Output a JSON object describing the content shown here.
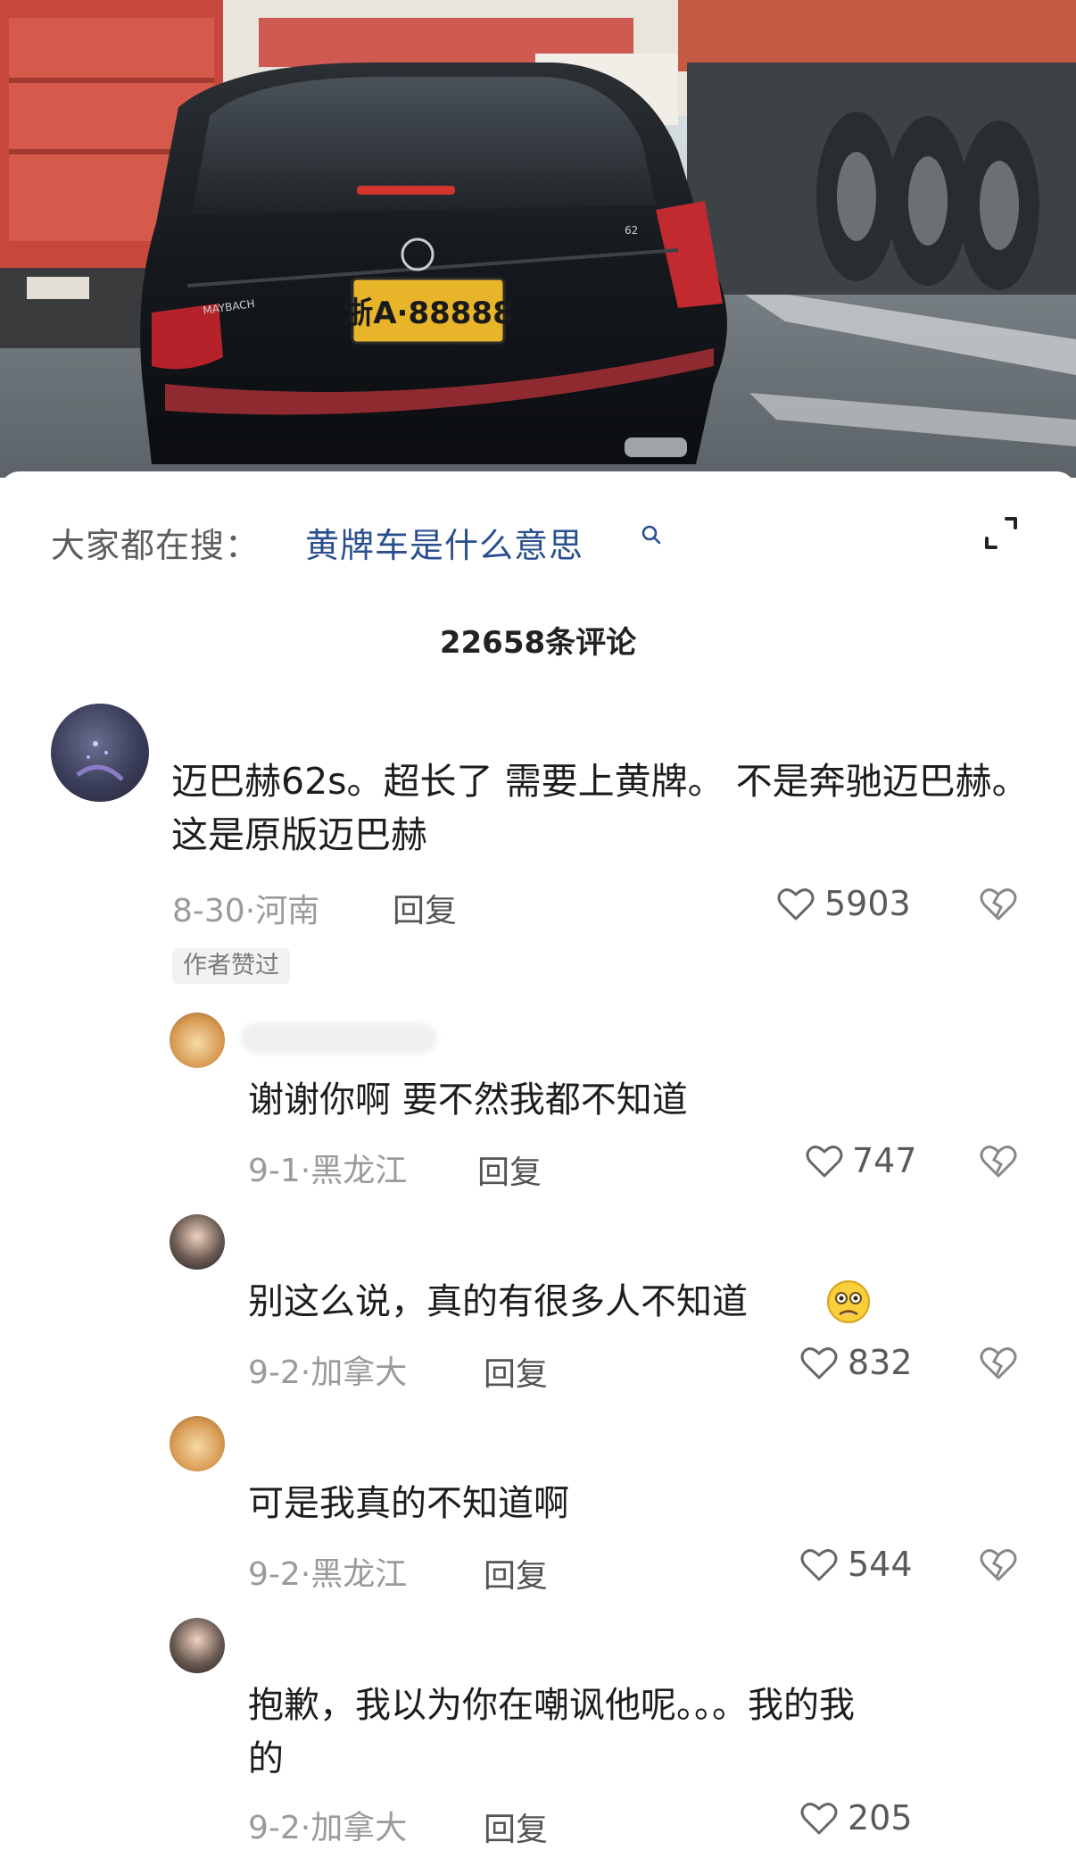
{
  "search_bar": {
    "prefix": "大家都在搜：",
    "query": "黄牌车是什么意思"
  },
  "photo": {
    "license_plate": "浙A·88888",
    "car_badge": "MAYBACH",
    "trunk_badge": "62"
  },
  "comment_count": "22658条评论",
  "comments": [
    {
      "text": "迈巴赫62s。超长了 需要上黄牌。  不是奔驰迈巴赫。这是原版迈巴赫",
      "date": "8-30·河南",
      "reply_label": "回复",
      "likes": "5903",
      "badge": "作者赞过"
    }
  ],
  "replies": [
    {
      "text": "谢谢你啊 要不然我都不知道",
      "date": "9-1·黑龙江",
      "reply_label": "回复",
      "likes": "747"
    },
    {
      "text": "别这么说，真的有很多人不知道",
      "date": "9-2·加拿大",
      "reply_label": "回复",
      "likes": "832",
      "emoji": "face-emoji"
    },
    {
      "text": "可是我真的不知道啊",
      "date": "9-2·黑龙江",
      "reply_label": "回复",
      "likes": "544"
    },
    {
      "text_line1": "抱歉，我以为你在嘲讽他呢。。。我的我",
      "text_line2": "的",
      "date": "9-2·加拿大",
      "reply_label": "回复",
      "likes": "205"
    }
  ],
  "colors": {
    "query_link": "#2a4f8f",
    "meta_gray": "#9a9a9a",
    "plate_yellow": "#e8b52a"
  }
}
